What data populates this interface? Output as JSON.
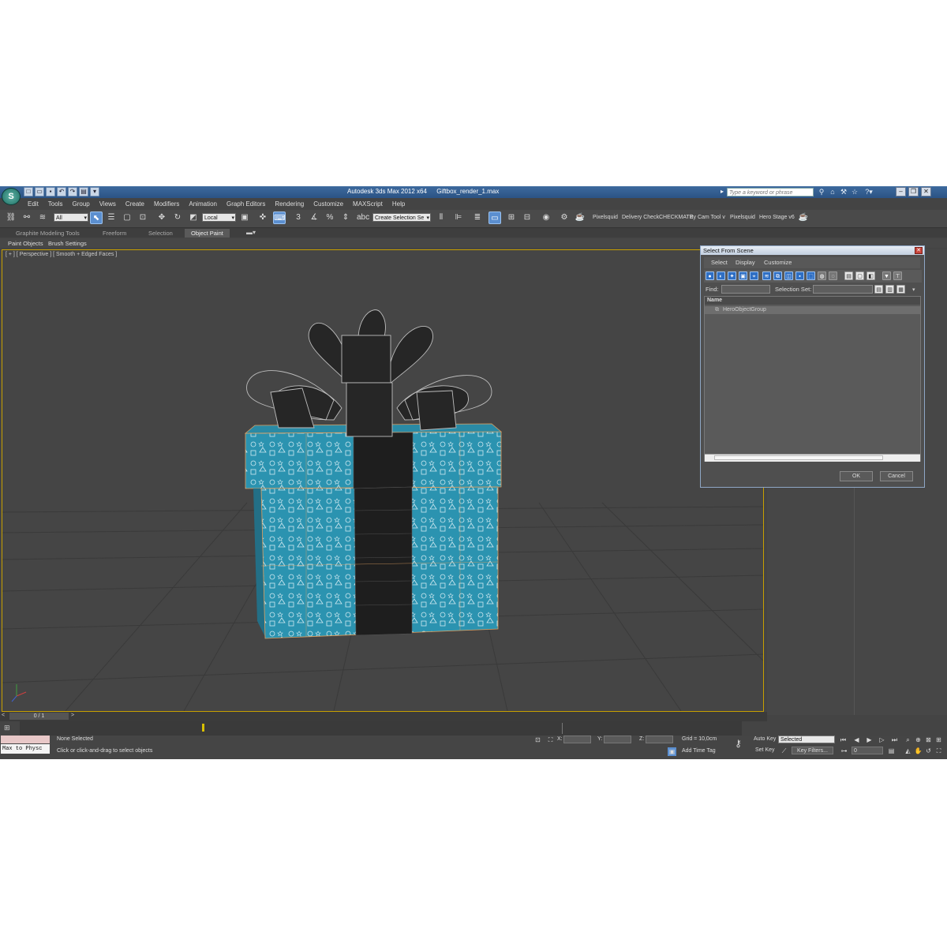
{
  "titlebar": {
    "app_name": "Autodesk 3ds Max  2012 x64",
    "file_name": "Giftbox_render_1.max",
    "search_placeholder": "Type a keyword or phrase"
  },
  "menu": [
    "Edit",
    "Tools",
    "Group",
    "Views",
    "Create",
    "Modifiers",
    "Animation",
    "Graph Editors",
    "Rendering",
    "Customize",
    "MAXScript",
    "Help"
  ],
  "toolbar": {
    "filter_value": "All",
    "coord_value": "Local",
    "selection_set_value": "Create Selection Se",
    "plugin_labels": [
      "Pixelsquid",
      "Delivery Check",
      "CHECKMATE",
      "ity Cam Tool v",
      "Pixelsquid",
      "Hero Stage v6"
    ]
  },
  "ribbon": {
    "tabs": [
      "Graphite Modeling Tools",
      "Freeform",
      "Selection",
      "Object Paint"
    ],
    "subtabs": [
      "Paint Objects",
      "Brush Settings"
    ]
  },
  "viewport": {
    "label": "[ + ] [ Perspective ] [ Smooth + Edged Faces ]"
  },
  "dialog": {
    "title": "Select From Scene",
    "menu": [
      "Select",
      "Display",
      "Customize"
    ],
    "find_label": "Find:",
    "selection_set_label": "Selection Set:",
    "column_header": "Name",
    "rows": [
      "HeroObjectGroup"
    ],
    "ok_label": "OK",
    "cancel_label": "Cancel"
  },
  "timeline": {
    "frame_counter": "0 / 1"
  },
  "status": {
    "maxscript_button": "Max to Physc",
    "selection_text": "None Selected",
    "prompt_text": "Click or click-and-drag to select objects",
    "x_label": "X:",
    "y_label": "Y:",
    "z_label": "Z:",
    "grid_text": "Grid = 10,0cm",
    "add_time_tag": "Add Time Tag",
    "auto_key": "Auto Key",
    "auto_key_dropdown": "Selected",
    "set_key": "Set Key",
    "key_filters": "Key Filters...",
    "frame_field": "0"
  },
  "colors": {
    "gift_wrap": "#2b93b0",
    "ribbon": "#1e1e1e",
    "viewport_border": "#c8a000",
    "highlight_blue": "#5b8fd0"
  }
}
